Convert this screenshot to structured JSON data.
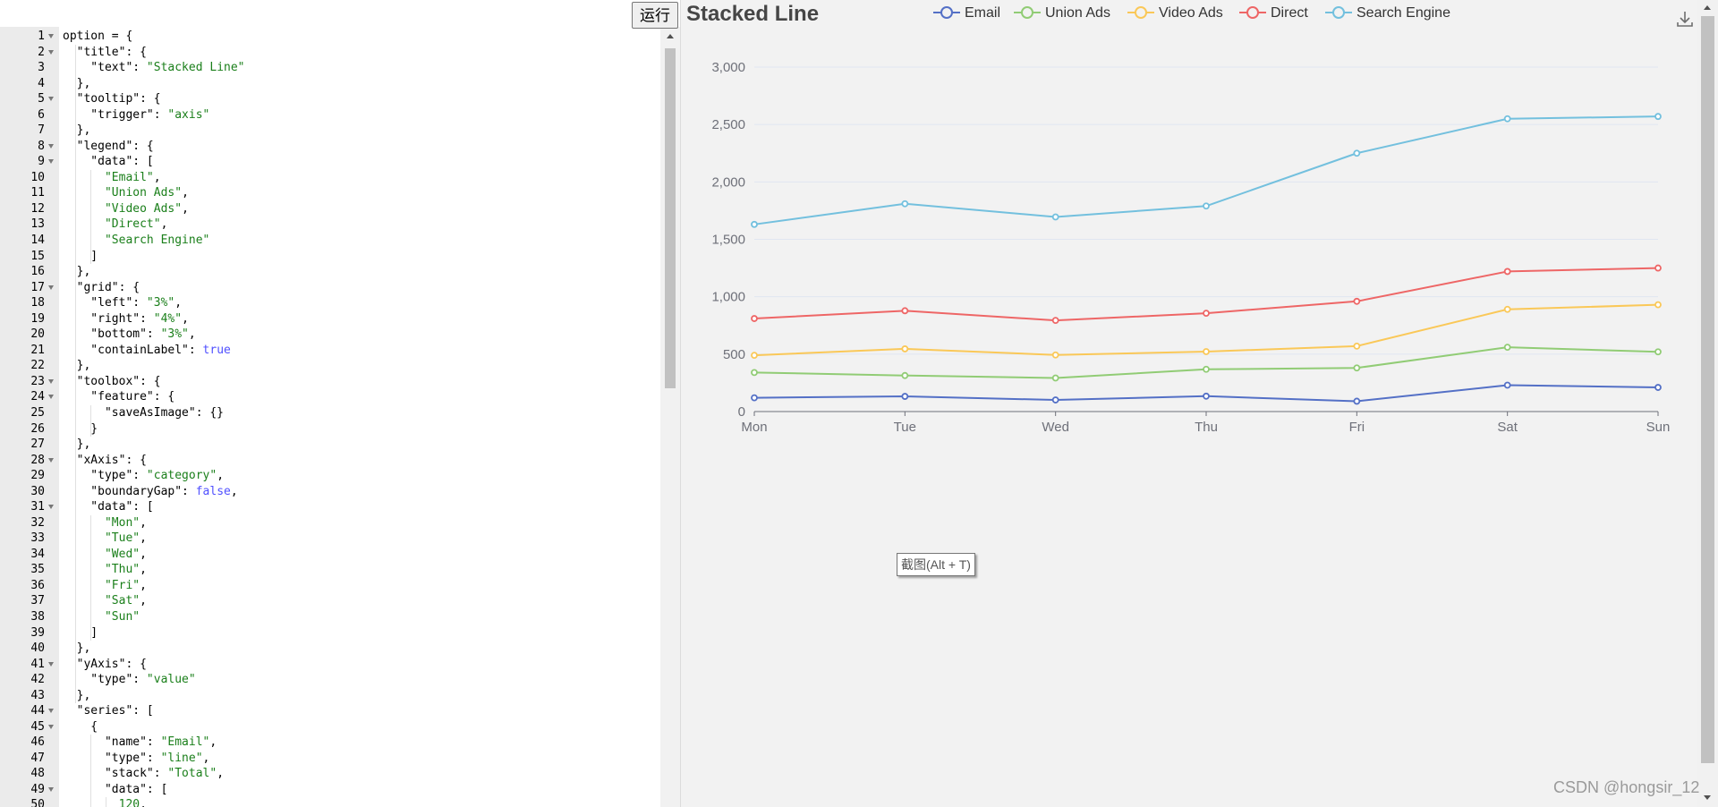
{
  "toolbar": {
    "run_label": "运行"
  },
  "editor": {
    "lines": [
      {
        "n": 1,
        "fold": true,
        "parts": [
          [
            "p",
            "option = {"
          ]
        ]
      },
      {
        "n": 2,
        "fold": true,
        "parts": [
          [
            "p",
            "  \"title\": {"
          ]
        ]
      },
      {
        "n": 3,
        "fold": false,
        "parts": [
          [
            "p",
            "    \"text\": "
          ],
          [
            "s",
            "\"Stacked Line\""
          ]
        ]
      },
      {
        "n": 4,
        "fold": false,
        "parts": [
          [
            "p",
            "  },"
          ]
        ]
      },
      {
        "n": 5,
        "fold": true,
        "parts": [
          [
            "p",
            "  \"tooltip\": {"
          ]
        ]
      },
      {
        "n": 6,
        "fold": false,
        "parts": [
          [
            "p",
            "    \"trigger\": "
          ],
          [
            "s",
            "\"axis\""
          ]
        ]
      },
      {
        "n": 7,
        "fold": false,
        "parts": [
          [
            "p",
            "  },"
          ]
        ]
      },
      {
        "n": 8,
        "fold": true,
        "parts": [
          [
            "p",
            "  \"legend\": {"
          ]
        ]
      },
      {
        "n": 9,
        "fold": true,
        "parts": [
          [
            "p",
            "    \"data\": ["
          ]
        ]
      },
      {
        "n": 10,
        "fold": false,
        "parts": [
          [
            "s",
            "      \"Email\""
          ],
          [
            "p",
            ","
          ]
        ]
      },
      {
        "n": 11,
        "fold": false,
        "parts": [
          [
            "s",
            "      \"Union Ads\""
          ],
          [
            "p",
            ","
          ]
        ]
      },
      {
        "n": 12,
        "fold": false,
        "parts": [
          [
            "s",
            "      \"Video Ads\""
          ],
          [
            "p",
            ","
          ]
        ]
      },
      {
        "n": 13,
        "fold": false,
        "parts": [
          [
            "s",
            "      \"Direct\""
          ],
          [
            "p",
            ","
          ]
        ]
      },
      {
        "n": 14,
        "fold": false,
        "parts": [
          [
            "s",
            "      \"Search Engine\""
          ]
        ]
      },
      {
        "n": 15,
        "fold": false,
        "parts": [
          [
            "p",
            "    ]"
          ]
        ]
      },
      {
        "n": 16,
        "fold": false,
        "parts": [
          [
            "p",
            "  },"
          ]
        ]
      },
      {
        "n": 17,
        "fold": true,
        "parts": [
          [
            "p",
            "  \"grid\": {"
          ]
        ]
      },
      {
        "n": 18,
        "fold": false,
        "parts": [
          [
            "p",
            "    \"left\": "
          ],
          [
            "s",
            "\"3%\""
          ],
          [
            "p",
            ","
          ]
        ]
      },
      {
        "n": 19,
        "fold": false,
        "parts": [
          [
            "p",
            "    \"right\": "
          ],
          [
            "s",
            "\"4%\""
          ],
          [
            "p",
            ","
          ]
        ]
      },
      {
        "n": 20,
        "fold": false,
        "parts": [
          [
            "p",
            "    \"bottom\": "
          ],
          [
            "s",
            "\"3%\""
          ],
          [
            "p",
            ","
          ]
        ]
      },
      {
        "n": 21,
        "fold": false,
        "parts": [
          [
            "p",
            "    \"containLabel\": "
          ],
          [
            "b",
            "true"
          ]
        ]
      },
      {
        "n": 22,
        "fold": false,
        "parts": [
          [
            "p",
            "  },"
          ]
        ]
      },
      {
        "n": 23,
        "fold": true,
        "parts": [
          [
            "p",
            "  \"toolbox\": {"
          ]
        ]
      },
      {
        "n": 24,
        "fold": true,
        "parts": [
          [
            "p",
            "    \"feature\": {"
          ]
        ]
      },
      {
        "n": 25,
        "fold": false,
        "parts": [
          [
            "p",
            "      \"saveAsImage\": {}"
          ]
        ]
      },
      {
        "n": 26,
        "fold": false,
        "parts": [
          [
            "p",
            "    }"
          ]
        ]
      },
      {
        "n": 27,
        "fold": false,
        "parts": [
          [
            "p",
            "  },"
          ]
        ]
      },
      {
        "n": 28,
        "fold": true,
        "parts": [
          [
            "p",
            "  \"xAxis\": {"
          ]
        ]
      },
      {
        "n": 29,
        "fold": false,
        "parts": [
          [
            "p",
            "    \"type\": "
          ],
          [
            "s",
            "\"category\""
          ],
          [
            "p",
            ","
          ]
        ]
      },
      {
        "n": 30,
        "fold": false,
        "parts": [
          [
            "p",
            "    \"boundaryGap\": "
          ],
          [
            "b",
            "false"
          ],
          [
            "p",
            ","
          ]
        ]
      },
      {
        "n": 31,
        "fold": true,
        "parts": [
          [
            "p",
            "    \"data\": ["
          ]
        ]
      },
      {
        "n": 32,
        "fold": false,
        "parts": [
          [
            "s",
            "      \"Mon\""
          ],
          [
            "p",
            ","
          ]
        ]
      },
      {
        "n": 33,
        "fold": false,
        "parts": [
          [
            "s",
            "      \"Tue\""
          ],
          [
            "p",
            ","
          ]
        ]
      },
      {
        "n": 34,
        "fold": false,
        "parts": [
          [
            "s",
            "      \"Wed\""
          ],
          [
            "p",
            ","
          ]
        ]
      },
      {
        "n": 35,
        "fold": false,
        "parts": [
          [
            "s",
            "      \"Thu\""
          ],
          [
            "p",
            ","
          ]
        ]
      },
      {
        "n": 36,
        "fold": false,
        "parts": [
          [
            "s",
            "      \"Fri\""
          ],
          [
            "p",
            ","
          ]
        ]
      },
      {
        "n": 37,
        "fold": false,
        "parts": [
          [
            "s",
            "      \"Sat\""
          ],
          [
            "p",
            ","
          ]
        ]
      },
      {
        "n": 38,
        "fold": false,
        "parts": [
          [
            "s",
            "      \"Sun\""
          ]
        ]
      },
      {
        "n": 39,
        "fold": false,
        "parts": [
          [
            "p",
            "    ]"
          ]
        ]
      },
      {
        "n": 40,
        "fold": false,
        "parts": [
          [
            "p",
            "  },"
          ]
        ]
      },
      {
        "n": 41,
        "fold": true,
        "parts": [
          [
            "p",
            "  \"yAxis\": {"
          ]
        ]
      },
      {
        "n": 42,
        "fold": false,
        "parts": [
          [
            "p",
            "    \"type\": "
          ],
          [
            "s",
            "\"value\""
          ]
        ]
      },
      {
        "n": 43,
        "fold": false,
        "parts": [
          [
            "p",
            "  },"
          ]
        ]
      },
      {
        "n": 44,
        "fold": true,
        "parts": [
          [
            "p",
            "  \"series\": ["
          ]
        ]
      },
      {
        "n": 45,
        "fold": true,
        "parts": [
          [
            "p",
            "    {"
          ]
        ]
      },
      {
        "n": 46,
        "fold": false,
        "parts": [
          [
            "p",
            "      \"name\": "
          ],
          [
            "s",
            "\"Email\""
          ],
          [
            "p",
            ","
          ]
        ]
      },
      {
        "n": 47,
        "fold": false,
        "parts": [
          [
            "p",
            "      \"type\": "
          ],
          [
            "s",
            "\"line\""
          ],
          [
            "p",
            ","
          ]
        ]
      },
      {
        "n": 48,
        "fold": false,
        "parts": [
          [
            "p",
            "      \"stack\": "
          ],
          [
            "s",
            "\"Total\""
          ],
          [
            "p",
            ","
          ]
        ]
      },
      {
        "n": 49,
        "fold": true,
        "parts": [
          [
            "p",
            "      \"data\": ["
          ]
        ]
      },
      {
        "n": 50,
        "fold": false,
        "parts": [
          [
            "s",
            "        120"
          ],
          [
            "p",
            ","
          ]
        ]
      }
    ]
  },
  "chart_data": {
    "type": "line",
    "title": "Stacked Line",
    "categories": [
      "Mon",
      "Tue",
      "Wed",
      "Thu",
      "Fri",
      "Sat",
      "Sun"
    ],
    "stacked": true,
    "series": [
      {
        "name": "Email",
        "color": "#5470c6",
        "values": [
          120,
          132,
          101,
          134,
          90,
          230,
          210
        ]
      },
      {
        "name": "Union Ads",
        "color": "#91cc75",
        "values": [
          220,
          182,
          191,
          234,
          290,
          330,
          310
        ]
      },
      {
        "name": "Video Ads",
        "color": "#fac858",
        "values": [
          150,
          232,
          201,
          154,
          190,
          330,
          410
        ]
      },
      {
        "name": "Direct",
        "color": "#ee6666",
        "values": [
          320,
          332,
          301,
          334,
          390,
          330,
          320
        ]
      },
      {
        "name": "Search Engine",
        "color": "#73c0de",
        "values": [
          820,
          932,
          901,
          934,
          1290,
          1330,
          1320
        ]
      }
    ],
    "y_ticks": [
      "0",
      "500",
      "1,000",
      "1,500",
      "2,000",
      "2,500",
      "3,000"
    ],
    "ylim": [
      0,
      3000
    ],
    "grid": true,
    "legend_position": "top-center"
  },
  "toolbox": {
    "icon": "download-icon"
  },
  "overlay": {
    "screenshot_tip": "截图(Alt + T)"
  },
  "footer": {
    "watermark": "CSDN @hongsir_12"
  }
}
